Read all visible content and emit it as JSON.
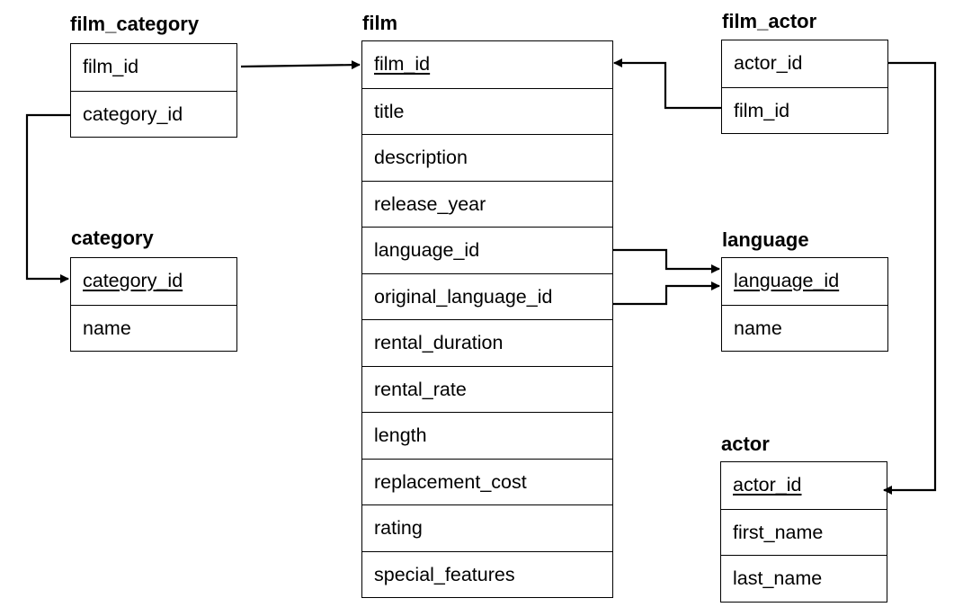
{
  "tables": {
    "film_category": {
      "name": "film_category",
      "columns": [
        {
          "label": "film_id",
          "pk": false
        },
        {
          "label": "category_id",
          "pk": false
        }
      ]
    },
    "category": {
      "name": "category",
      "columns": [
        {
          "label": "category_id",
          "pk": true
        },
        {
          "label": "name",
          "pk": false
        }
      ]
    },
    "film": {
      "name": "film",
      "columns": [
        {
          "label": "film_id",
          "pk": true
        },
        {
          "label": "title",
          "pk": false
        },
        {
          "label": "description",
          "pk": false
        },
        {
          "label": "release_year",
          "pk": false
        },
        {
          "label": "language_id",
          "pk": false
        },
        {
          "label": "original_language_id",
          "pk": false
        },
        {
          "label": "rental_duration",
          "pk": false
        },
        {
          "label": "rental_rate",
          "pk": false
        },
        {
          "label": "length",
          "pk": false
        },
        {
          "label": "replacement_cost",
          "pk": false
        },
        {
          "label": "rating",
          "pk": false
        },
        {
          "label": "special_features",
          "pk": false
        }
      ]
    },
    "film_actor": {
      "name": "film_actor",
      "columns": [
        {
          "label": "actor_id",
          "pk": false
        },
        {
          "label": "film_id",
          "pk": false
        }
      ]
    },
    "language": {
      "name": "language",
      "columns": [
        {
          "label": "language_id",
          "pk": true
        },
        {
          "label": "name",
          "pk": false
        }
      ]
    },
    "actor": {
      "name": "actor",
      "columns": [
        {
          "label": "actor_id",
          "pk": true
        },
        {
          "label": "first_name",
          "pk": false
        },
        {
          "label": "last_name",
          "pk": false
        }
      ]
    }
  },
  "relationships": [
    {
      "from": "film_category.film_id",
      "to": "film.film_id"
    },
    {
      "from": "film_category.category_id",
      "to": "category.category_id"
    },
    {
      "from": "film_actor.film_id",
      "to": "film.film_id"
    },
    {
      "from": "film_actor.actor_id",
      "to": "actor.actor_id"
    },
    {
      "from": "film.language_id",
      "to": "language.language_id"
    },
    {
      "from": "film.original_language_id",
      "to": "language.language_id"
    }
  ]
}
